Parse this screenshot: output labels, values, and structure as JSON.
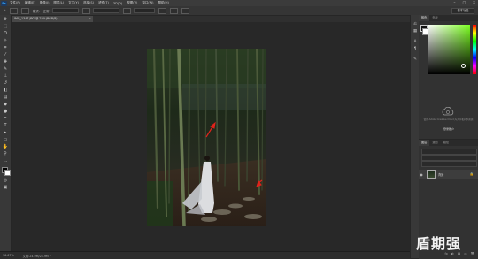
{
  "menubar": {
    "logo": "Ps",
    "items": [
      "文件(F)",
      "编辑(E)",
      "图像(I)",
      "图层(L)",
      "文字(Y)",
      "选择(S)",
      "滤镜(T)",
      "3D(D)",
      "视图(V)",
      "窗口(W)",
      "帮助(H)"
    ]
  },
  "options": {
    "mode_label": "模式:",
    "mode_value": "正常",
    "workspace": "基本功能"
  },
  "document": {
    "tab_title": "IMG_1347.JPG @ 25%(RGB/8)",
    "tab_close": "×"
  },
  "status": {
    "zoom": "16.67%",
    "doc_size": "文档:24.9M/24.9M"
  },
  "panels": {
    "color_tabs": [
      "颜色",
      "色板"
    ],
    "learn_text": "使用 Adobe Creative Cloud 库共享和同步资源",
    "learn_button": "登录账户",
    "layers_tabs": [
      "图层",
      "通道",
      "路径"
    ],
    "layer_name": "背景",
    "layer_lock": "🔒",
    "footer_icons": [
      "fx",
      "◐",
      "▣",
      "▭",
      "🗑"
    ]
  },
  "watermark": "盾期强",
  "colors": {
    "accent": "#31a8ff",
    "arrow": "#e0231b"
  }
}
